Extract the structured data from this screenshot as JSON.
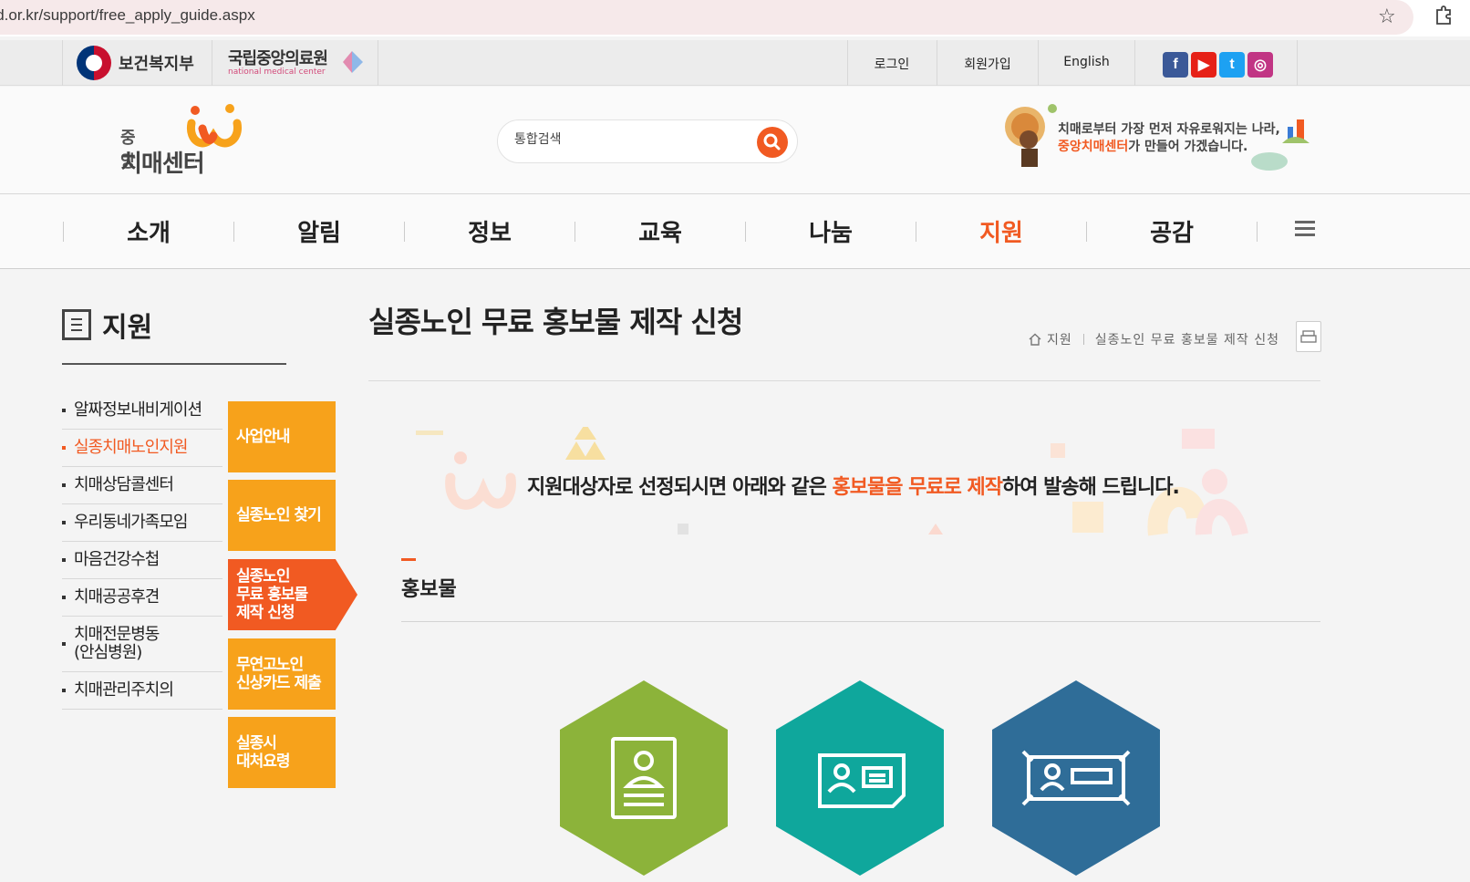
{
  "browser": {
    "url": "nid.or.kr/support/free_apply_guide.aspx"
  },
  "utility": {
    "mohw": "보건복지부",
    "nmc_ko": "국립중앙의료원",
    "nmc_en": "national medical center",
    "links": [
      {
        "label": "로그인"
      },
      {
        "label": "회원가입"
      },
      {
        "label": "English"
      }
    ],
    "sns": [
      {
        "icon": "facebook-icon",
        "glyph": "f",
        "color": "#3b5998"
      },
      {
        "icon": "youtube-icon",
        "glyph": "▶",
        "color": "#e62117"
      },
      {
        "icon": "twitter-icon",
        "glyph": "t",
        "color": "#1da1f2"
      },
      {
        "icon": "instagram-icon",
        "glyph": "◎",
        "color": "#c13584"
      }
    ]
  },
  "header": {
    "brand_small": "중앙",
    "brand_big": "치매센터",
    "search_placeholder": "통합검색",
    "slogan_line1": "치매로부터 가장 먼저 자유로워지는 나라,",
    "slogan_hl": "중앙치매센터",
    "slogan_rest": "가 만들어 가겠습니다."
  },
  "gnb": {
    "items": [
      {
        "label": "소개"
      },
      {
        "label": "알림"
      },
      {
        "label": "정보"
      },
      {
        "label": "교육"
      },
      {
        "label": "나눔"
      },
      {
        "label": "지원"
      },
      {
        "label": "공감"
      }
    ],
    "active_index": 5
  },
  "lnb": {
    "title": "지원",
    "items": [
      {
        "label": "알짜정보내비게이션"
      },
      {
        "label": "실종치매노인지원"
      },
      {
        "label": "치매상담콜센터"
      },
      {
        "label": "우리동네가족모임"
      },
      {
        "label": "마음건강수첩"
      },
      {
        "label": "치매공공후견"
      },
      {
        "label": "치매전문병동\n(안심병원)"
      },
      {
        "label": "치매관리주치의"
      }
    ],
    "sub_items": [
      {
        "label": "사업안내"
      },
      {
        "label": "실종노인 찾기"
      },
      {
        "label": "실종노인\n무료 홍보물\n제작 신청"
      },
      {
        "label": "무연고노인\n신상카드 제출"
      },
      {
        "label": "실종시\n대처요령"
      }
    ]
  },
  "content": {
    "page_title": "실종노인 무료 홍보물 제작 신청",
    "breadcrumb": [
      "지원",
      "실종노인 무료 홍보물 제작 신청"
    ],
    "intro_before": "지원대상자로 선정되시면 아래와 같은 ",
    "intro_hl": "홍보물을 무료로 제작",
    "intro_after": "하여 발송해 드립니다.",
    "section_title": "홍보물",
    "products": [
      {
        "icon": "id-card-icon",
        "color": "#8cb33a"
      },
      {
        "icon": "name-card-icon",
        "color": "#0fa79c"
      },
      {
        "icon": "banner-icon",
        "color": "#2f6d98"
      }
    ]
  },
  "colors": {
    "accent": "#f15a22",
    "sub_menu": "#f7a21b"
  }
}
